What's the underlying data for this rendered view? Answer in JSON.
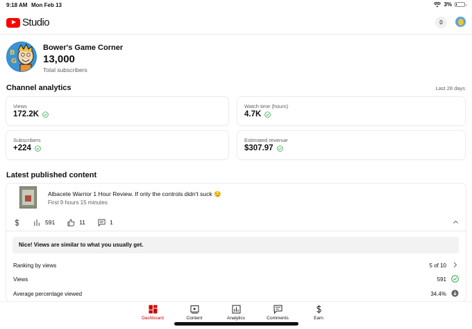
{
  "status_bar": {
    "time": "9:18 AM",
    "date": "Mon Feb 13",
    "battery": "3%",
    "battery_level": 0.03
  },
  "app": {
    "logo_text": "Studio",
    "notifications": "0"
  },
  "channel": {
    "name": "Bower's Game Corner",
    "subscribers": "13,000",
    "subscribers_label": "Total subscribers"
  },
  "analytics": {
    "title": "Channel analytics",
    "range": "Last 28 days",
    "cards": [
      {
        "label": "Views",
        "value": "172.2K"
      },
      {
        "label": "Watch time (hours)",
        "value": "4.7K"
      },
      {
        "label": "Subscribers",
        "value": "+224"
      },
      {
        "label": "Estimated revenue",
        "value": "$307.97"
      }
    ]
  },
  "latest": {
    "title": "Latest published content",
    "video_title": "Albacete Warrior 1 Hour Review. If only the controls didn't suck 😏",
    "video_subtitle": "First 9 hours 15 minutes",
    "views": "591",
    "likes": "11",
    "comments": "1",
    "banner": "Nice! Views are similar to what you usually get.",
    "metrics": [
      {
        "label": "Ranking by views",
        "value": "5 of 10",
        "icon": "chevron-right-icon"
      },
      {
        "label": "Views",
        "value": "591",
        "icon": "check-circle-icon"
      },
      {
        "label": "Average percentage viewed",
        "value": "34.4%",
        "icon": "arrow-down-circle-icon"
      }
    ]
  },
  "nav": [
    {
      "label": "Dashboard",
      "icon": "dashboard-icon",
      "active": true
    },
    {
      "label": "Content",
      "icon": "content-icon",
      "active": false
    },
    {
      "label": "Analytics",
      "icon": "analytics-icon",
      "active": false
    },
    {
      "label": "Comments",
      "icon": "comments-icon",
      "active": false
    },
    {
      "label": "Earn",
      "icon": "dollar-icon",
      "active": false
    }
  ],
  "colors": {
    "accent": "#cc0000",
    "brand": "#ff0000",
    "check": "#2ba640"
  }
}
